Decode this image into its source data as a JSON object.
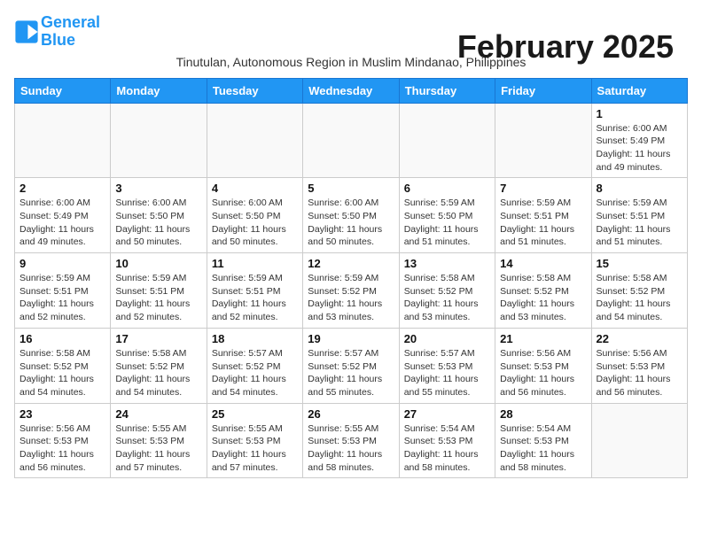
{
  "header": {
    "logo_line1": "General",
    "logo_line2": "Blue",
    "month_year": "February 2025",
    "location": "Tinutulan, Autonomous Region in Muslim Mindanao, Philippines"
  },
  "weekdays": [
    "Sunday",
    "Monday",
    "Tuesday",
    "Wednesday",
    "Thursday",
    "Friday",
    "Saturday"
  ],
  "weeks": [
    [
      {
        "day": "",
        "info": ""
      },
      {
        "day": "",
        "info": ""
      },
      {
        "day": "",
        "info": ""
      },
      {
        "day": "",
        "info": ""
      },
      {
        "day": "",
        "info": ""
      },
      {
        "day": "",
        "info": ""
      },
      {
        "day": "1",
        "info": "Sunrise: 6:00 AM\nSunset: 5:49 PM\nDaylight: 11 hours\nand 49 minutes."
      }
    ],
    [
      {
        "day": "2",
        "info": "Sunrise: 6:00 AM\nSunset: 5:49 PM\nDaylight: 11 hours\nand 49 minutes."
      },
      {
        "day": "3",
        "info": "Sunrise: 6:00 AM\nSunset: 5:50 PM\nDaylight: 11 hours\nand 50 minutes."
      },
      {
        "day": "4",
        "info": "Sunrise: 6:00 AM\nSunset: 5:50 PM\nDaylight: 11 hours\nand 50 minutes."
      },
      {
        "day": "5",
        "info": "Sunrise: 6:00 AM\nSunset: 5:50 PM\nDaylight: 11 hours\nand 50 minutes."
      },
      {
        "day": "6",
        "info": "Sunrise: 5:59 AM\nSunset: 5:50 PM\nDaylight: 11 hours\nand 51 minutes."
      },
      {
        "day": "7",
        "info": "Sunrise: 5:59 AM\nSunset: 5:51 PM\nDaylight: 11 hours\nand 51 minutes."
      },
      {
        "day": "8",
        "info": "Sunrise: 5:59 AM\nSunset: 5:51 PM\nDaylight: 11 hours\nand 51 minutes."
      }
    ],
    [
      {
        "day": "9",
        "info": "Sunrise: 5:59 AM\nSunset: 5:51 PM\nDaylight: 11 hours\nand 52 minutes."
      },
      {
        "day": "10",
        "info": "Sunrise: 5:59 AM\nSunset: 5:51 PM\nDaylight: 11 hours\nand 52 minutes."
      },
      {
        "day": "11",
        "info": "Sunrise: 5:59 AM\nSunset: 5:51 PM\nDaylight: 11 hours\nand 52 minutes."
      },
      {
        "day": "12",
        "info": "Sunrise: 5:59 AM\nSunset: 5:52 PM\nDaylight: 11 hours\nand 53 minutes."
      },
      {
        "day": "13",
        "info": "Sunrise: 5:58 AM\nSunset: 5:52 PM\nDaylight: 11 hours\nand 53 minutes."
      },
      {
        "day": "14",
        "info": "Sunrise: 5:58 AM\nSunset: 5:52 PM\nDaylight: 11 hours\nand 53 minutes."
      },
      {
        "day": "15",
        "info": "Sunrise: 5:58 AM\nSunset: 5:52 PM\nDaylight: 11 hours\nand 54 minutes."
      }
    ],
    [
      {
        "day": "16",
        "info": "Sunrise: 5:58 AM\nSunset: 5:52 PM\nDaylight: 11 hours\nand 54 minutes."
      },
      {
        "day": "17",
        "info": "Sunrise: 5:58 AM\nSunset: 5:52 PM\nDaylight: 11 hours\nand 54 minutes."
      },
      {
        "day": "18",
        "info": "Sunrise: 5:57 AM\nSunset: 5:52 PM\nDaylight: 11 hours\nand 54 minutes."
      },
      {
        "day": "19",
        "info": "Sunrise: 5:57 AM\nSunset: 5:52 PM\nDaylight: 11 hours\nand 55 minutes."
      },
      {
        "day": "20",
        "info": "Sunrise: 5:57 AM\nSunset: 5:53 PM\nDaylight: 11 hours\nand 55 minutes."
      },
      {
        "day": "21",
        "info": "Sunrise: 5:56 AM\nSunset: 5:53 PM\nDaylight: 11 hours\nand 56 minutes."
      },
      {
        "day": "22",
        "info": "Sunrise: 5:56 AM\nSunset: 5:53 PM\nDaylight: 11 hours\nand 56 minutes."
      }
    ],
    [
      {
        "day": "23",
        "info": "Sunrise: 5:56 AM\nSunset: 5:53 PM\nDaylight: 11 hours\nand 56 minutes."
      },
      {
        "day": "24",
        "info": "Sunrise: 5:55 AM\nSunset: 5:53 PM\nDaylight: 11 hours\nand 57 minutes."
      },
      {
        "day": "25",
        "info": "Sunrise: 5:55 AM\nSunset: 5:53 PM\nDaylight: 11 hours\nand 57 minutes."
      },
      {
        "day": "26",
        "info": "Sunrise: 5:55 AM\nSunset: 5:53 PM\nDaylight: 11 hours\nand 58 minutes."
      },
      {
        "day": "27",
        "info": "Sunrise: 5:54 AM\nSunset: 5:53 PM\nDaylight: 11 hours\nand 58 minutes."
      },
      {
        "day": "28",
        "info": "Sunrise: 5:54 AM\nSunset: 5:53 PM\nDaylight: 11 hours\nand 58 minutes."
      },
      {
        "day": "",
        "info": ""
      }
    ]
  ]
}
